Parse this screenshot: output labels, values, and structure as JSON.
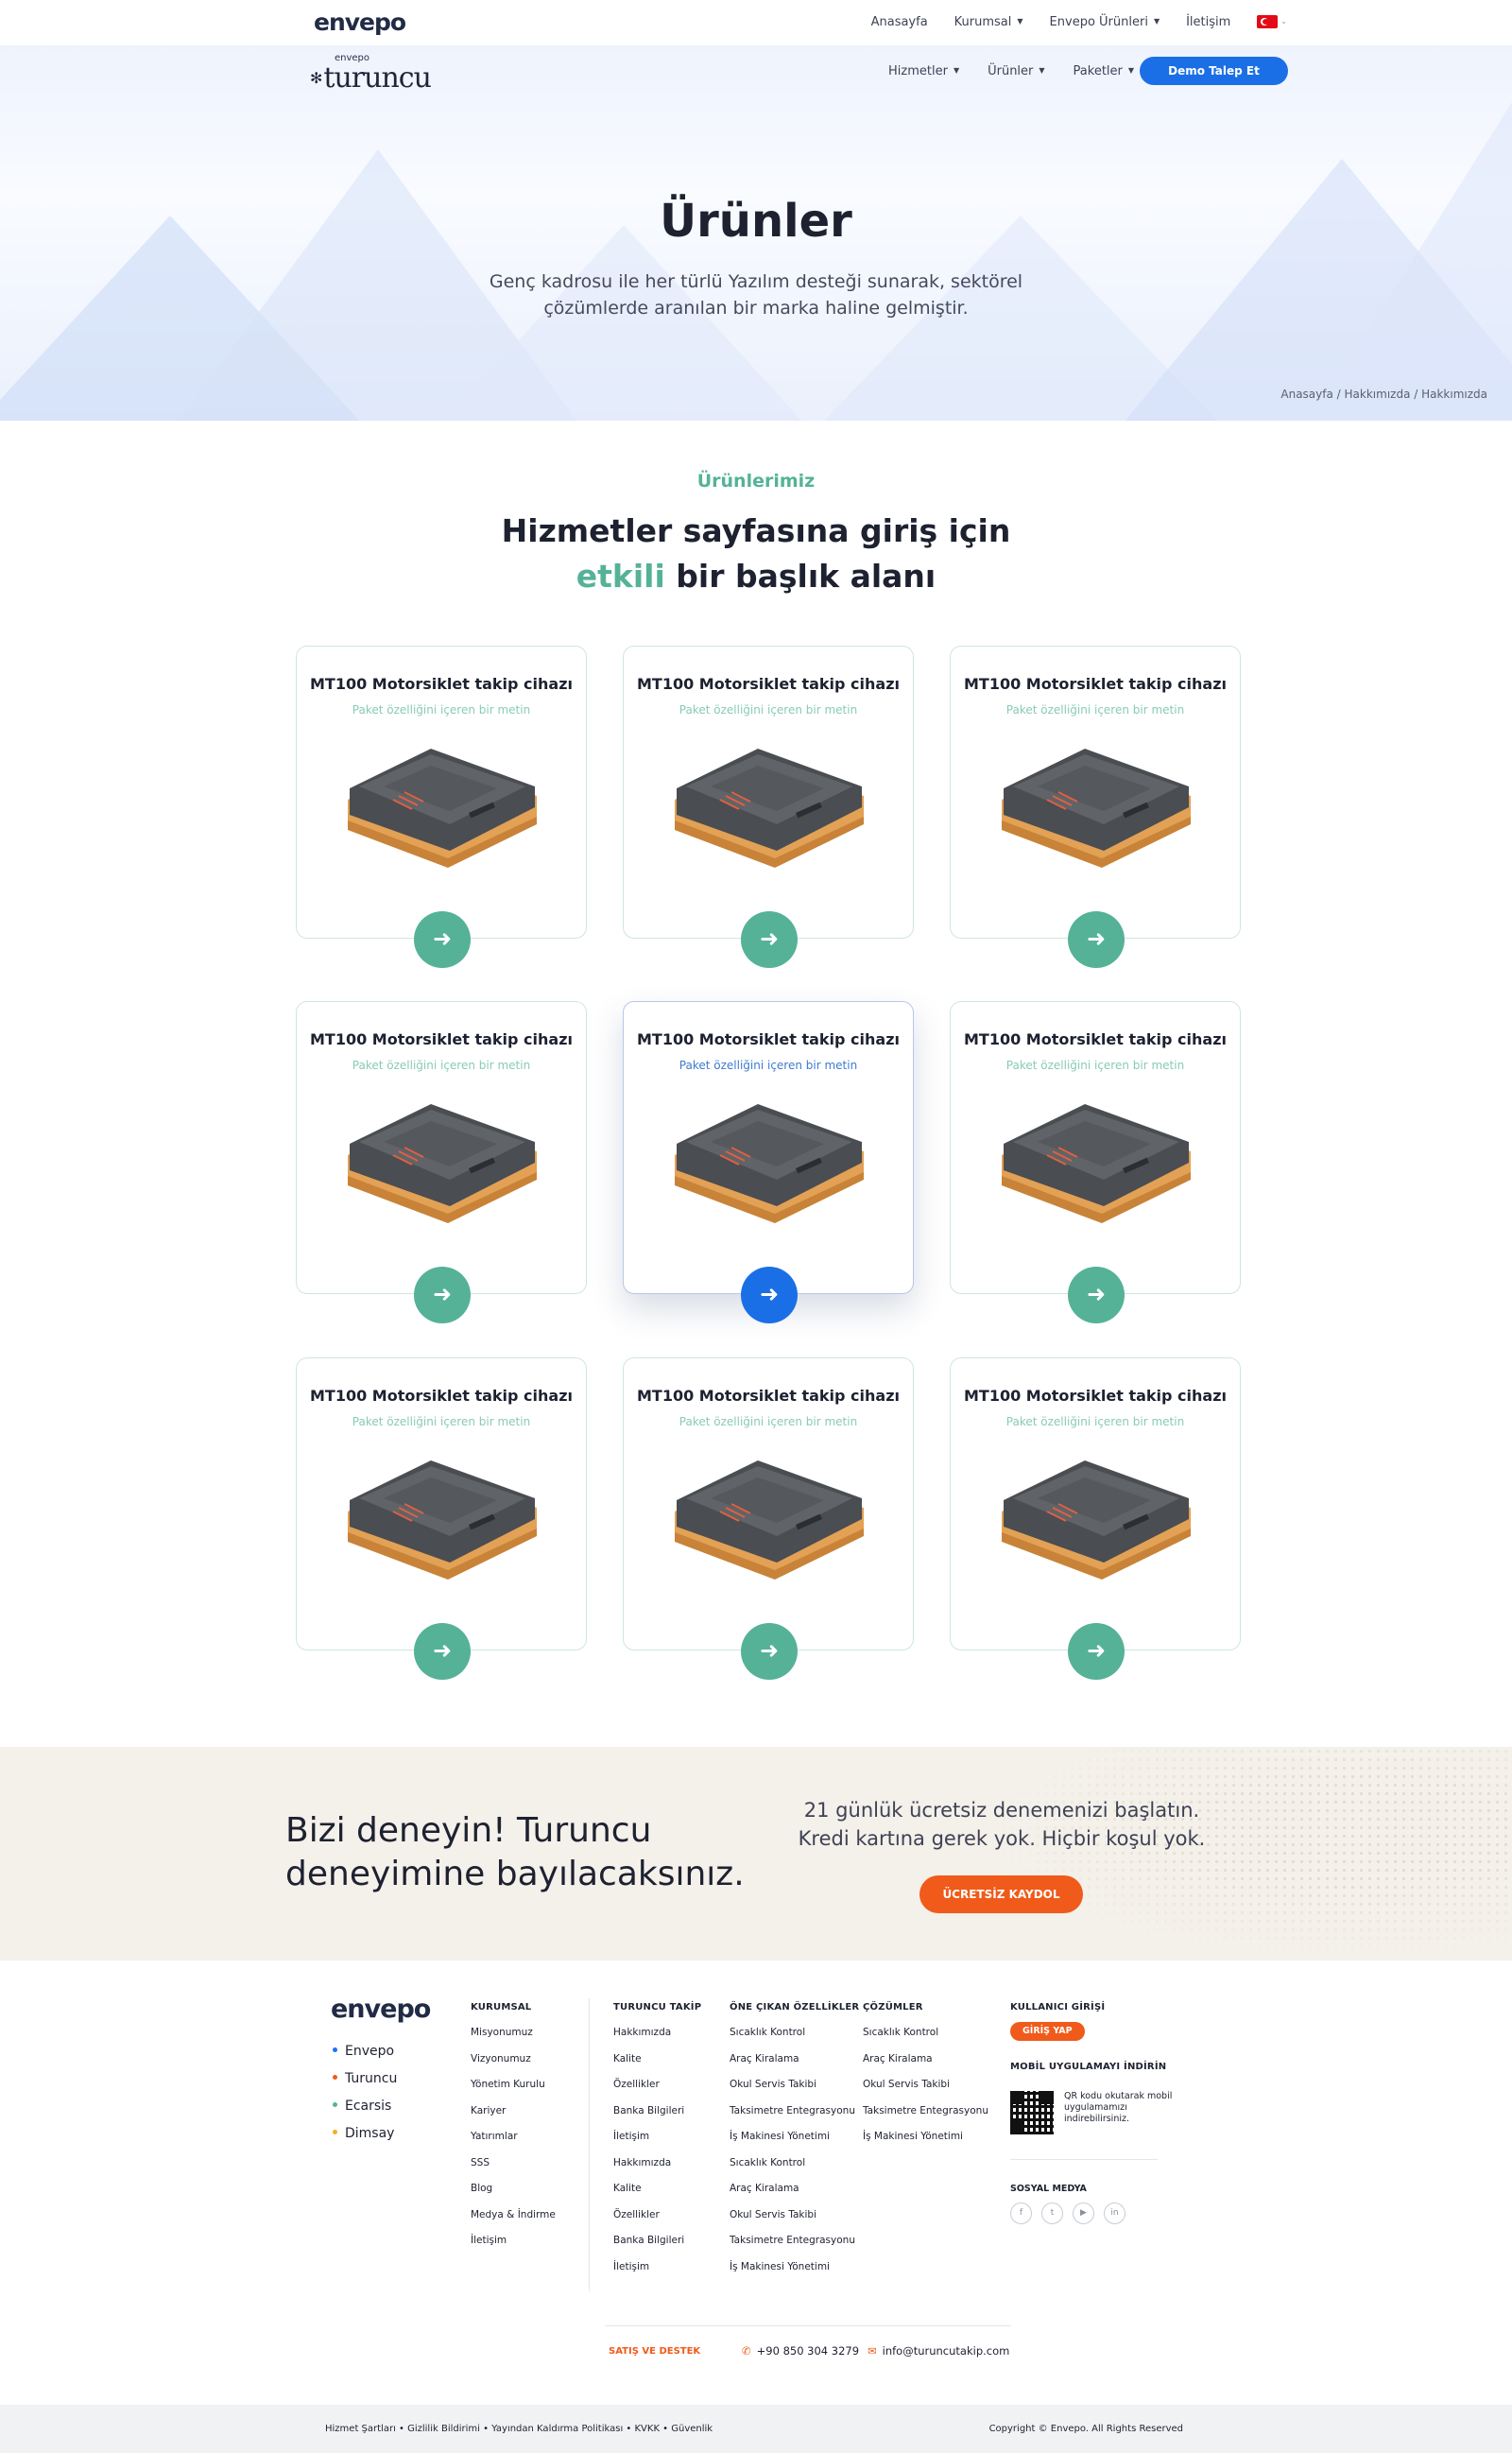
{
  "topbar": {
    "logo": "envepo",
    "nav": [
      {
        "label": "Anasayfa",
        "caret": false
      },
      {
        "label": "Kurumsal",
        "caret": true
      },
      {
        "label": "Envepo Ürünleri",
        "caret": true
      },
      {
        "label": "İletişim",
        "caret": false
      }
    ],
    "language_flag_icon": "turkey-flag-icon"
  },
  "mainnav": {
    "brand_small": "envepo",
    "brand_word": "turuncu",
    "links": [
      "Hizmetler",
      "Ürünler",
      "Paketler"
    ],
    "demo_button": "Demo Talep Et"
  },
  "hero": {
    "title": "Ürünler",
    "subtitle": "Genç kadrosu ile her türlü Yazılım desteği sunarak, sektörel çözümlerde aranılan bir marka haline gelmiştir.",
    "breadcrumb": "Anasayfa / Hakkımızda / Hakkımızda"
  },
  "products": {
    "eyebrow": "Ürünlerimiz",
    "title_line1": "Hizmetler sayfasına giriş için",
    "title_accent": "etkili",
    "title_rest": " bir başlık alanı",
    "cards": [
      {
        "title": "MT100 Motorsiklet takip cihazı",
        "subtitle": "Paket özelliğini içeren bir metin",
        "active": false
      },
      {
        "title": "MT100 Motorsiklet takip cihazı",
        "subtitle": "Paket özelliğini içeren bir metin",
        "active": false
      },
      {
        "title": "MT100 Motorsiklet takip cihazı",
        "subtitle": "Paket özelliğini içeren bir metin",
        "active": false
      },
      {
        "title": "MT100 Motorsiklet takip cihazı",
        "subtitle": "Paket özelliğini içeren bir metin",
        "active": false
      },
      {
        "title": "MT100 Motorsiklet takip cihazı",
        "subtitle": "Paket özelliğini içeren bir metin",
        "active": true
      },
      {
        "title": "MT100 Motorsiklet takip cihazı",
        "subtitle": "Paket özelliğini içeren bir metin",
        "active": false
      },
      {
        "title": "MT100 Motorsiklet takip cihazı",
        "subtitle": "Paket özelliğini içeren bir metin",
        "active": false
      },
      {
        "title": "MT100 Motorsiklet takip cihazı",
        "subtitle": "Paket özelliğini içeren bir metin",
        "active": false
      },
      {
        "title": "MT100 Motorsiklet takip cihazı",
        "subtitle": "Paket özelliğini içeren bir metin",
        "active": false
      }
    ],
    "arrow_icon": "arrow-right-icon"
  },
  "cta": {
    "headline": "Bizi deneyin! Turuncu deneyimine bayılacaksınız.",
    "text": "21 günlük ücretsiz denemenizi başlatın. Kredi kartına gerek yok. Hiçbir koşul yok.",
    "button": "ÜCRETSİZ KAYDOL"
  },
  "footer": {
    "logo": "envepo",
    "brands": [
      {
        "label": "Envepo",
        "color": "#1b72ff"
      },
      {
        "label": "Turuncu",
        "color": "#f05a1a"
      },
      {
        "label": "Ecarsis",
        "color": "#55b297"
      },
      {
        "label": "Dimsay",
        "color": "#f2b01e"
      }
    ],
    "columns": [
      {
        "title": "KURUMSAL",
        "items": [
          "Misyonumuz",
          "Vizyonumuz",
          "Yönetim Kurulu",
          "Kariyer",
          "Yatırımlar",
          "SSS",
          "Blog",
          "Medya & İndirme",
          "İletişim"
        ]
      },
      {
        "title": "TURUNCU TAKİP",
        "items": [
          "Hakkımızda",
          "Kalite",
          "Özellikler",
          "Banka Bilgileri",
          "İletişim",
          "Hakkımızda",
          "Kalite",
          "Özellikler",
          "Banka Bilgileri",
          "İletişim"
        ]
      },
      {
        "title": "ÖNE ÇIKAN ÖZELLİKLER",
        "items": [
          "Sıcaklık Kontrol",
          "Araç Kiralama",
          "Okul Servis Takibi",
          "Taksimetre Entegrasyonu",
          "İş Makinesi Yönetimi",
          "Sıcaklık Kontrol",
          "Araç Kiralama",
          "Okul Servis Takibi",
          "Taksimetre Entegrasyonu",
          "İş Makinesi Yönetimi"
        ]
      },
      {
        "title": "ÇÖZÜMLER",
        "items": [
          "Sıcaklık Kontrol",
          "Araç Kiralama",
          "Okul Servis Takibi",
          "Taksimetre Entegrasyonu",
          "İş Makinesi Yönetimi"
        ]
      }
    ],
    "login": {
      "title": "KULLANICI GİRİŞİ",
      "button": "GİRİŞ YAP"
    },
    "mobile": {
      "title": "MOBİL UYGULAMAYI İNDİRİN",
      "text": "QR kodu okutarak mobil uygulamamızı indirebilirsiniz."
    },
    "social": {
      "title": "SOSYAL MEDYA",
      "icons": [
        "f",
        "t",
        "▶",
        "in"
      ]
    },
    "contact": {
      "label": "SATIŞ VE DESTEK",
      "phone": "+90 850 304 3279",
      "email": "info@turuncutakip.com"
    }
  },
  "bottom": {
    "links": "Hizmet Şartları  •  Gizlilik Bildirimi  •  Yayından Kaldırma Politikası  •  KVKK  •  Güvenlik",
    "copyright": "Copyright © Envepo. All Rights Reserved"
  }
}
